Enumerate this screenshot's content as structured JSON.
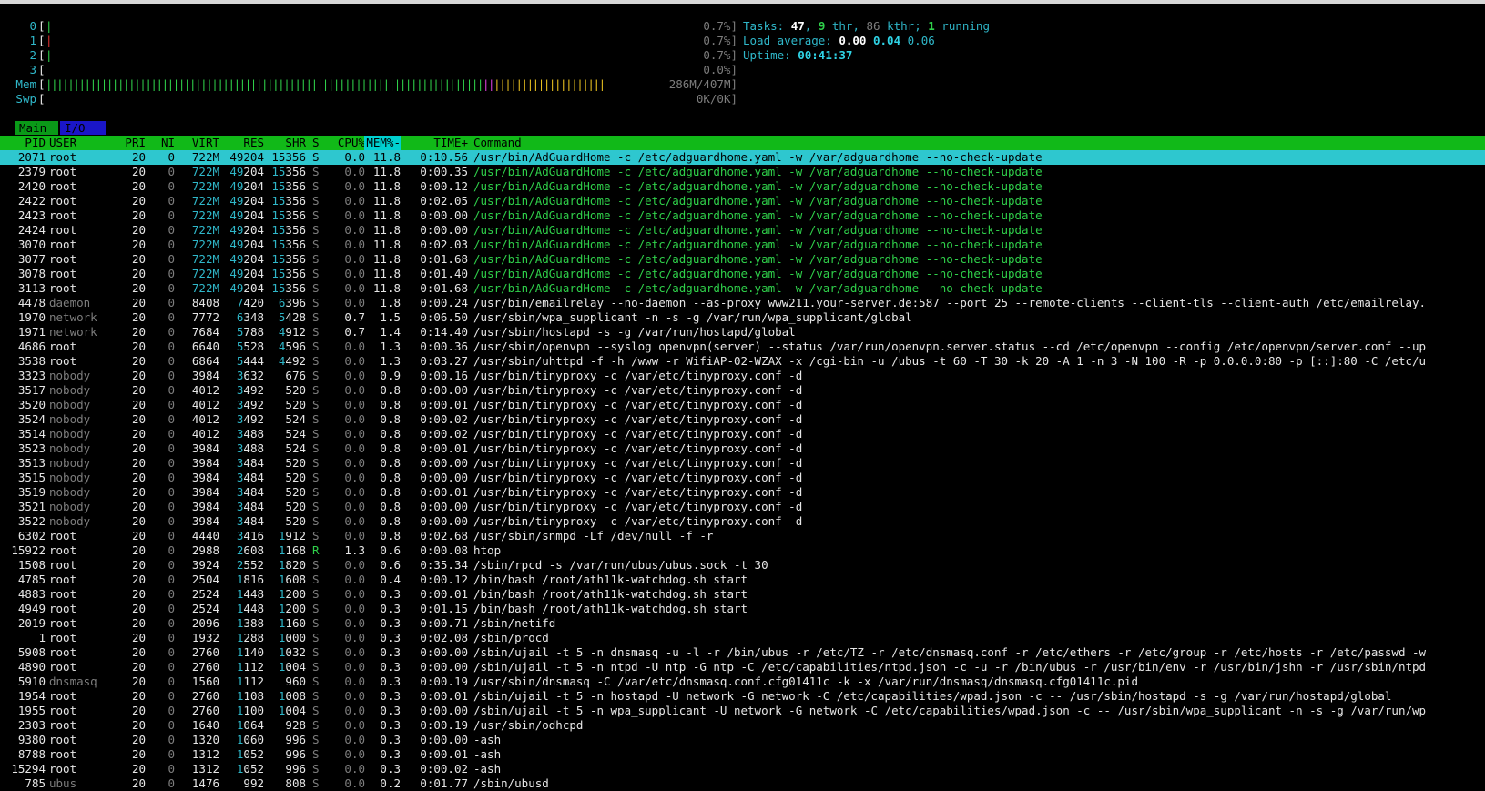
{
  "meters": {
    "cpu": [
      {
        "label": "0",
        "value": "0.7%]",
        "bar": "|",
        "color": "#2fd04a"
      },
      {
        "label": "1",
        "value": "0.7%]",
        "bar": "|",
        "color": "#e03030"
      },
      {
        "label": "2",
        "value": "0.7%]",
        "bar": "|",
        "color": "#2fd04a"
      },
      {
        "label": "3",
        "value": "0.0%]",
        "bar": "",
        "color": "#2fd04a"
      }
    ],
    "mem": {
      "label": "Mem",
      "value": "286M/407M]",
      "used_fraction": 0.703
    },
    "swp": {
      "label": "Swp",
      "value": "0K/0K]"
    }
  },
  "info": {
    "tasks_label": "Tasks: ",
    "tasks": "47",
    "thr": "9",
    "thr_label": " thr, ",
    "kthr": "86",
    "kthr_label": " kthr; ",
    "running": "1",
    "running_label": " running",
    "load_label": "Load average: ",
    "load1": "0.00",
    "load5": "0.04",
    "load15": "0.06",
    "uptime_label": "Uptime: ",
    "uptime": "00:41:37"
  },
  "tabs": {
    "main": "Main",
    "io": "I/O"
  },
  "header": {
    "pid": "PID",
    "user": "USER",
    "pri": "PRI",
    "ni": "NI",
    "virt": "VIRT",
    "res": "RES",
    "shr": "SHR",
    "s": "S",
    "cpu": "CPU%",
    "mem": "MEM%-",
    "time": "TIME+",
    "cmd": "Command"
  },
  "processes": [
    {
      "pid": "2071",
      "user": "root",
      "pri": "20",
      "ni": "0",
      "virt": "722M",
      "res": "49204",
      "shr": "15356",
      "s": "S",
      "cpu": "0.0",
      "mem": "11.8",
      "time": "0:10.56",
      "cmd": "/usr/bin/AdGuardHome -c /etc/adguardhome.yaml -w /var/adguardhome --no-check-update",
      "selected": true
    },
    {
      "pid": "2379",
      "user": "root",
      "pri": "20",
      "ni": "0",
      "virt": "722M",
      "res": "49204",
      "shr": "15356",
      "s": "S",
      "cpu": "0.0",
      "mem": "11.8",
      "time": "0:00.35",
      "cmd": "/usr/bin/AdGuardHome -c /etc/adguardhome.yaml -w /var/adguardhome --no-check-update",
      "thread": true
    },
    {
      "pid": "2420",
      "user": "root",
      "pri": "20",
      "ni": "0",
      "virt": "722M",
      "res": "49204",
      "shr": "15356",
      "s": "S",
      "cpu": "0.0",
      "mem": "11.8",
      "time": "0:00.12",
      "cmd": "/usr/bin/AdGuardHome -c /etc/adguardhome.yaml -w /var/adguardhome --no-check-update",
      "thread": true
    },
    {
      "pid": "2422",
      "user": "root",
      "pri": "20",
      "ni": "0",
      "virt": "722M",
      "res": "49204",
      "shr": "15356",
      "s": "S",
      "cpu": "0.0",
      "mem": "11.8",
      "time": "0:02.05",
      "cmd": "/usr/bin/AdGuardHome -c /etc/adguardhome.yaml -w /var/adguardhome --no-check-update",
      "thread": true
    },
    {
      "pid": "2423",
      "user": "root",
      "pri": "20",
      "ni": "0",
      "virt": "722M",
      "res": "49204",
      "shr": "15356",
      "s": "S",
      "cpu": "0.0",
      "mem": "11.8",
      "time": "0:00.00",
      "cmd": "/usr/bin/AdGuardHome -c /etc/adguardhome.yaml -w /var/adguardhome --no-check-update",
      "thread": true
    },
    {
      "pid": "2424",
      "user": "root",
      "pri": "20",
      "ni": "0",
      "virt": "722M",
      "res": "49204",
      "shr": "15356",
      "s": "S",
      "cpu": "0.0",
      "mem": "11.8",
      "time": "0:00.00",
      "cmd": "/usr/bin/AdGuardHome -c /etc/adguardhome.yaml -w /var/adguardhome --no-check-update",
      "thread": true
    },
    {
      "pid": "3070",
      "user": "root",
      "pri": "20",
      "ni": "0",
      "virt": "722M",
      "res": "49204",
      "shr": "15356",
      "s": "S",
      "cpu": "0.0",
      "mem": "11.8",
      "time": "0:02.03",
      "cmd": "/usr/bin/AdGuardHome -c /etc/adguardhome.yaml -w /var/adguardhome --no-check-update",
      "thread": true
    },
    {
      "pid": "3077",
      "user": "root",
      "pri": "20",
      "ni": "0",
      "virt": "722M",
      "res": "49204",
      "shr": "15356",
      "s": "S",
      "cpu": "0.0",
      "mem": "11.8",
      "time": "0:01.68",
      "cmd": "/usr/bin/AdGuardHome -c /etc/adguardhome.yaml -w /var/adguardhome --no-check-update",
      "thread": true
    },
    {
      "pid": "3078",
      "user": "root",
      "pri": "20",
      "ni": "0",
      "virt": "722M",
      "res": "49204",
      "shr": "15356",
      "s": "S",
      "cpu": "0.0",
      "mem": "11.8",
      "time": "0:01.40",
      "cmd": "/usr/bin/AdGuardHome -c /etc/adguardhome.yaml -w /var/adguardhome --no-check-update",
      "thread": true
    },
    {
      "pid": "3113",
      "user": "root",
      "pri": "20",
      "ni": "0",
      "virt": "722M",
      "res": "49204",
      "shr": "15356",
      "s": "S",
      "cpu": "0.0",
      "mem": "11.8",
      "time": "0:01.68",
      "cmd": "/usr/bin/AdGuardHome -c /etc/adguardhome.yaml -w /var/adguardhome --no-check-update",
      "thread": true
    },
    {
      "pid": "4478",
      "user": "daemon",
      "pri": "20",
      "ni": "0",
      "virt": "8408",
      "res": "7420",
      "shr": "6396",
      "s": "S",
      "cpu": "0.0",
      "mem": "1.8",
      "time": "0:00.24",
      "cmd": "/usr/bin/emailrelay --no-daemon --as-proxy www211.your-server.de:587 --port 25 --remote-clients --client-tls --client-auth /etc/emailrelay."
    },
    {
      "pid": "1970",
      "user": "network",
      "pri": "20",
      "ni": "0",
      "virt": "7772",
      "res": "6348",
      "shr": "5428",
      "s": "S",
      "cpu": "0.7",
      "mem": "1.5",
      "time": "0:06.50",
      "cmd": "/usr/sbin/wpa_supplicant -n -s -g /var/run/wpa_supplicant/global"
    },
    {
      "pid": "1971",
      "user": "network",
      "pri": "20",
      "ni": "0",
      "virt": "7684",
      "res": "5788",
      "shr": "4912",
      "s": "S",
      "cpu": "0.7",
      "mem": "1.4",
      "time": "0:14.40",
      "cmd": "/usr/sbin/hostapd -s -g /var/run/hostapd/global"
    },
    {
      "pid": "4686",
      "user": "root",
      "pri": "20",
      "ni": "0",
      "virt": "6640",
      "res": "5528",
      "shr": "4596",
      "s": "S",
      "cpu": "0.0",
      "mem": "1.3",
      "time": "0:00.36",
      "cmd": "/usr/sbin/openvpn --syslog openvpn(server) --status /var/run/openvpn.server.status --cd /etc/openvpn --config /etc/openvpn/server.conf --up"
    },
    {
      "pid": "3538",
      "user": "root",
      "pri": "20",
      "ni": "0",
      "virt": "6864",
      "res": "5444",
      "shr": "4492",
      "s": "S",
      "cpu": "0.0",
      "mem": "1.3",
      "time": "0:03.27",
      "cmd": "/usr/sbin/uhttpd -f -h /www -r WifiAP-02-WZAX -x /cgi-bin -u /ubus -t 60 -T 30 -k 20 -A 1 -n 3 -N 100 -R -p 0.0.0.0:80 -p [::]:80 -C /etc/u"
    },
    {
      "pid": "3323",
      "user": "nobody",
      "pri": "20",
      "ni": "0",
      "virt": "3984",
      "res": "3632",
      "shr": "676",
      "s": "S",
      "cpu": "0.0",
      "mem": "0.9",
      "time": "0:00.16",
      "cmd": "/usr/bin/tinyproxy -c /var/etc/tinyproxy.conf -d"
    },
    {
      "pid": "3517",
      "user": "nobody",
      "pri": "20",
      "ni": "0",
      "virt": "4012",
      "res": "3492",
      "shr": "520",
      "s": "S",
      "cpu": "0.0",
      "mem": "0.8",
      "time": "0:00.00",
      "cmd": "/usr/bin/tinyproxy -c /var/etc/tinyproxy.conf -d"
    },
    {
      "pid": "3520",
      "user": "nobody",
      "pri": "20",
      "ni": "0",
      "virt": "4012",
      "res": "3492",
      "shr": "520",
      "s": "S",
      "cpu": "0.0",
      "mem": "0.8",
      "time": "0:00.01",
      "cmd": "/usr/bin/tinyproxy -c /var/etc/tinyproxy.conf -d"
    },
    {
      "pid": "3524",
      "user": "nobody",
      "pri": "20",
      "ni": "0",
      "virt": "4012",
      "res": "3492",
      "shr": "524",
      "s": "S",
      "cpu": "0.0",
      "mem": "0.8",
      "time": "0:00.02",
      "cmd": "/usr/bin/tinyproxy -c /var/etc/tinyproxy.conf -d"
    },
    {
      "pid": "3514",
      "user": "nobody",
      "pri": "20",
      "ni": "0",
      "virt": "4012",
      "res": "3488",
      "shr": "524",
      "s": "S",
      "cpu": "0.0",
      "mem": "0.8",
      "time": "0:00.02",
      "cmd": "/usr/bin/tinyproxy -c /var/etc/tinyproxy.conf -d"
    },
    {
      "pid": "3523",
      "user": "nobody",
      "pri": "20",
      "ni": "0",
      "virt": "3984",
      "res": "3488",
      "shr": "524",
      "s": "S",
      "cpu": "0.0",
      "mem": "0.8",
      "time": "0:00.01",
      "cmd": "/usr/bin/tinyproxy -c /var/etc/tinyproxy.conf -d"
    },
    {
      "pid": "3513",
      "user": "nobody",
      "pri": "20",
      "ni": "0",
      "virt": "3984",
      "res": "3484",
      "shr": "520",
      "s": "S",
      "cpu": "0.0",
      "mem": "0.8",
      "time": "0:00.00",
      "cmd": "/usr/bin/tinyproxy -c /var/etc/tinyproxy.conf -d"
    },
    {
      "pid": "3515",
      "user": "nobody",
      "pri": "20",
      "ni": "0",
      "virt": "3984",
      "res": "3484",
      "shr": "520",
      "s": "S",
      "cpu": "0.0",
      "mem": "0.8",
      "time": "0:00.00",
      "cmd": "/usr/bin/tinyproxy -c /var/etc/tinyproxy.conf -d"
    },
    {
      "pid": "3519",
      "user": "nobody",
      "pri": "20",
      "ni": "0",
      "virt": "3984",
      "res": "3484",
      "shr": "520",
      "s": "S",
      "cpu": "0.0",
      "mem": "0.8",
      "time": "0:00.01",
      "cmd": "/usr/bin/tinyproxy -c /var/etc/tinyproxy.conf -d"
    },
    {
      "pid": "3521",
      "user": "nobody",
      "pri": "20",
      "ni": "0",
      "virt": "3984",
      "res": "3484",
      "shr": "520",
      "s": "S",
      "cpu": "0.0",
      "mem": "0.8",
      "time": "0:00.00",
      "cmd": "/usr/bin/tinyproxy -c /var/etc/tinyproxy.conf -d"
    },
    {
      "pid": "3522",
      "user": "nobody",
      "pri": "20",
      "ni": "0",
      "virt": "3984",
      "res": "3484",
      "shr": "520",
      "s": "S",
      "cpu": "0.0",
      "mem": "0.8",
      "time": "0:00.00",
      "cmd": "/usr/bin/tinyproxy -c /var/etc/tinyproxy.conf -d"
    },
    {
      "pid": "6302",
      "user": "root",
      "pri": "20",
      "ni": "0",
      "virt": "4440",
      "res": "3416",
      "shr": "1912",
      "s": "S",
      "cpu": "0.0",
      "mem": "0.8",
      "time": "0:02.68",
      "cmd": "/usr/sbin/snmpd -Lf /dev/null -f -r"
    },
    {
      "pid": "15922",
      "user": "root",
      "pri": "20",
      "ni": "0",
      "virt": "2988",
      "res": "2608",
      "shr": "1168",
      "s": "R",
      "cpu": "1.3",
      "mem": "0.6",
      "time": "0:00.08",
      "cmd": "htop"
    },
    {
      "pid": "1508",
      "user": "root",
      "pri": "20",
      "ni": "0",
      "virt": "3924",
      "res": "2552",
      "shr": "1820",
      "s": "S",
      "cpu": "0.0",
      "mem": "0.6",
      "time": "0:35.34",
      "cmd": "/sbin/rpcd -s /var/run/ubus/ubus.sock -t 30"
    },
    {
      "pid": "4785",
      "user": "root",
      "pri": "20",
      "ni": "0",
      "virt": "2504",
      "res": "1816",
      "shr": "1608",
      "s": "S",
      "cpu": "0.0",
      "mem": "0.4",
      "time": "0:00.12",
      "cmd": "/bin/bash /root/ath11k-watchdog.sh start"
    },
    {
      "pid": "4883",
      "user": "root",
      "pri": "20",
      "ni": "0",
      "virt": "2524",
      "res": "1448",
      "shr": "1200",
      "s": "S",
      "cpu": "0.0",
      "mem": "0.3",
      "time": "0:00.01",
      "cmd": "/bin/bash /root/ath11k-watchdog.sh start"
    },
    {
      "pid": "4949",
      "user": "root",
      "pri": "20",
      "ni": "0",
      "virt": "2524",
      "res": "1448",
      "shr": "1200",
      "s": "S",
      "cpu": "0.0",
      "mem": "0.3",
      "time": "0:01.15",
      "cmd": "/bin/bash /root/ath11k-watchdog.sh start"
    },
    {
      "pid": "2019",
      "user": "root",
      "pri": "20",
      "ni": "0",
      "virt": "2096",
      "res": "1388",
      "shr": "1160",
      "s": "S",
      "cpu": "0.0",
      "mem": "0.3",
      "time": "0:00.71",
      "cmd": "/sbin/netifd"
    },
    {
      "pid": "1",
      "user": "root",
      "pri": "20",
      "ni": "0",
      "virt": "1932",
      "res": "1288",
      "shr": "1000",
      "s": "S",
      "cpu": "0.0",
      "mem": "0.3",
      "time": "0:02.08",
      "cmd": "/sbin/procd"
    },
    {
      "pid": "5908",
      "user": "root",
      "pri": "20",
      "ni": "0",
      "virt": "2760",
      "res": "1140",
      "shr": "1032",
      "s": "S",
      "cpu": "0.0",
      "mem": "0.3",
      "time": "0:00.00",
      "cmd": "/sbin/ujail -t 5 -n dnsmasq -u -l -r /bin/ubus -r /etc/TZ -r /etc/dnsmasq.conf -r /etc/ethers -r /etc/group -r /etc/hosts -r /etc/passwd -w"
    },
    {
      "pid": "4890",
      "user": "root",
      "pri": "20",
      "ni": "0",
      "virt": "2760",
      "res": "1112",
      "shr": "1004",
      "s": "S",
      "cpu": "0.0",
      "mem": "0.3",
      "time": "0:00.00",
      "cmd": "/sbin/ujail -t 5 -n ntpd -U ntp -G ntp -C /etc/capabilities/ntpd.json -c -u -r /bin/ubus -r /usr/bin/env -r /usr/bin/jshn -r /usr/sbin/ntpd"
    },
    {
      "pid": "5910",
      "user": "dnsmasq",
      "pri": "20",
      "ni": "0",
      "virt": "1560",
      "res": "1112",
      "shr": "960",
      "s": "S",
      "cpu": "0.0",
      "mem": "0.3",
      "time": "0:00.19",
      "cmd": "/usr/sbin/dnsmasq -C /var/etc/dnsmasq.conf.cfg01411c -k -x /var/run/dnsmasq/dnsmasq.cfg01411c.pid"
    },
    {
      "pid": "1954",
      "user": "root",
      "pri": "20",
      "ni": "0",
      "virt": "2760",
      "res": "1108",
      "shr": "1008",
      "s": "S",
      "cpu": "0.0",
      "mem": "0.3",
      "time": "0:00.01",
      "cmd": "/sbin/ujail -t 5 -n hostapd -U network -G network -C /etc/capabilities/wpad.json -c -- /usr/sbin/hostapd -s -g /var/run/hostapd/global"
    },
    {
      "pid": "1955",
      "user": "root",
      "pri": "20",
      "ni": "0",
      "virt": "2760",
      "res": "1100",
      "shr": "1004",
      "s": "S",
      "cpu": "0.0",
      "mem": "0.3",
      "time": "0:00.00",
      "cmd": "/sbin/ujail -t 5 -n wpa_supplicant -U network -G network -C /etc/capabilities/wpad.json -c -- /usr/sbin/wpa_supplicant -n -s -g /var/run/wp"
    },
    {
      "pid": "2303",
      "user": "root",
      "pri": "20",
      "ni": "0",
      "virt": "1640",
      "res": "1064",
      "shr": "928",
      "s": "S",
      "cpu": "0.0",
      "mem": "0.3",
      "time": "0:00.19",
      "cmd": "/usr/sbin/odhcpd"
    },
    {
      "pid": "9380",
      "user": "root",
      "pri": "20",
      "ni": "0",
      "virt": "1320",
      "res": "1060",
      "shr": "996",
      "s": "S",
      "cpu": "0.0",
      "mem": "0.3",
      "time": "0:00.00",
      "cmd": "-ash"
    },
    {
      "pid": "8788",
      "user": "root",
      "pri": "20",
      "ni": "0",
      "virt": "1312",
      "res": "1052",
      "shr": "996",
      "s": "S",
      "cpu": "0.0",
      "mem": "0.3",
      "time": "0:00.01",
      "cmd": "-ash"
    },
    {
      "pid": "15294",
      "user": "root",
      "pri": "20",
      "ni": "0",
      "virt": "1312",
      "res": "1052",
      "shr": "996",
      "s": "S",
      "cpu": "0.0",
      "mem": "0.3",
      "time": "0:00.02",
      "cmd": "-ash"
    },
    {
      "pid": "785",
      "user": "ubus",
      "pri": "20",
      "ni": "0",
      "virt": "1476",
      "res": "992",
      "shr": "808",
      "s": "S",
      "cpu": "0.0",
      "mem": "0.2",
      "time": "0:01.77",
      "cmd": "/sbin/ubusd"
    }
  ]
}
